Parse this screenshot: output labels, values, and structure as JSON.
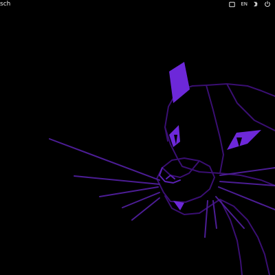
{
  "topbar": {
    "app_title": "sch",
    "keyboard_layout": "EN",
    "tray_icons": [
      "window-icon",
      "keyboard-layout",
      "bluetooth-icon",
      "power-icon"
    ]
  },
  "desktop": {
    "wallpaper_icon": "panther-wallpaper",
    "colors": {
      "background": "#000000",
      "line_dark": "#3a0f73",
      "line": "#4c1d95",
      "accent": "#6d28d9",
      "accent_bright": "#7c3aed"
    }
  }
}
